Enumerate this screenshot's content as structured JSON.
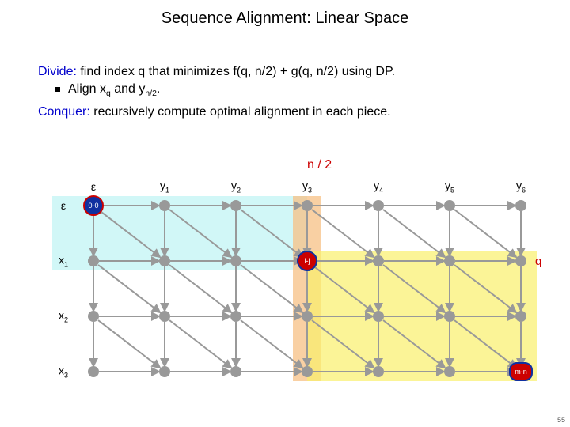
{
  "title": "Sequence Alignment:  Linear Space",
  "text": {
    "divide_kw": "Divide:",
    "divide_rest": "  find index q that minimizes f(q, n/2) + g(q, n/2) using DP.",
    "align_line_pre": "Align x",
    "align_line_sub1": "q",
    "align_line_mid": " and y",
    "align_line_sub2": "n/2",
    "align_line_post": ".",
    "conquer_kw": "Conquer:",
    "conquer_rest": "  recursively compute optimal alignment in each piece."
  },
  "diagram": {
    "n2_label": "n / 2",
    "q_label": "q",
    "col_eps": "ε",
    "row_eps": "ε",
    "col_labels": [
      "y",
      "y",
      "y",
      "y",
      "y",
      "y"
    ],
    "col_subs": [
      "1",
      "2",
      "3",
      "4",
      "5",
      "6"
    ],
    "row_labels": [
      "x",
      "x",
      "x"
    ],
    "row_subs": [
      "1",
      "2",
      "3"
    ],
    "node00": "0-0",
    "node_ij": "i-j",
    "node_mn": "m-n"
  },
  "pagenum": "55"
}
